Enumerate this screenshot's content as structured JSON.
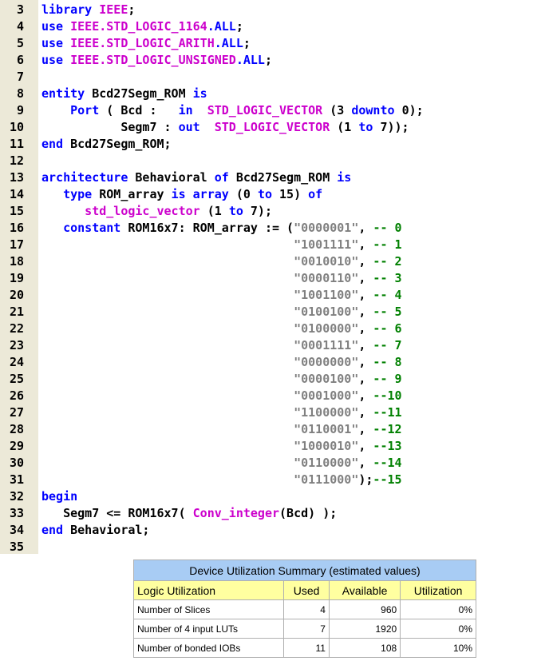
{
  "code_lines": [
    {
      "n": "3",
      "tokens": [
        {
          "t": "library ",
          "c": "kw"
        },
        {
          "t": "IEEE",
          "c": "ty"
        },
        {
          "t": ";",
          "c": "id"
        }
      ]
    },
    {
      "n": "4",
      "tokens": [
        {
          "t": "use ",
          "c": "kw"
        },
        {
          "t": "IEEE.STD_LOGIC_1164",
          "c": "ty"
        },
        {
          "t": ".ALL",
          "c": "kw"
        },
        {
          "t": ";",
          "c": "id"
        }
      ]
    },
    {
      "n": "5",
      "tokens": [
        {
          "t": "use ",
          "c": "kw"
        },
        {
          "t": "IEEE.STD_LOGIC_ARITH",
          "c": "ty"
        },
        {
          "t": ".ALL",
          "c": "kw"
        },
        {
          "t": ";",
          "c": "id"
        }
      ]
    },
    {
      "n": "6",
      "tokens": [
        {
          "t": "use ",
          "c": "kw"
        },
        {
          "t": "IEEE.STD_LOGIC_UNSIGNED",
          "c": "ty"
        },
        {
          "t": ".ALL",
          "c": "kw"
        },
        {
          "t": ";",
          "c": "id"
        }
      ]
    },
    {
      "n": "7",
      "tokens": []
    },
    {
      "n": "8",
      "tokens": [
        {
          "t": "entity ",
          "c": "kw"
        },
        {
          "t": "Bcd27Segm_ROM ",
          "c": "id"
        },
        {
          "t": "is",
          "c": "kw"
        }
      ]
    },
    {
      "n": "9",
      "tokens": [
        {
          "t": "    Port ",
          "c": "kw"
        },
        {
          "t": "( Bcd :   ",
          "c": "id"
        },
        {
          "t": "in  ",
          "c": "kw"
        },
        {
          "t": "STD_LOGIC_VECTOR ",
          "c": "ty"
        },
        {
          "t": "(3 ",
          "c": "id"
        },
        {
          "t": "downto ",
          "c": "kw"
        },
        {
          "t": "0);",
          "c": "id"
        }
      ]
    },
    {
      "n": "10",
      "tokens": [
        {
          "t": "           Segm7 : ",
          "c": "id"
        },
        {
          "t": "out  ",
          "c": "kw"
        },
        {
          "t": "STD_LOGIC_VECTOR ",
          "c": "ty"
        },
        {
          "t": "(1 ",
          "c": "id"
        },
        {
          "t": "to ",
          "c": "kw"
        },
        {
          "t": "7));",
          "c": "id"
        }
      ]
    },
    {
      "n": "11",
      "tokens": [
        {
          "t": "end ",
          "c": "kw"
        },
        {
          "t": "Bcd27Segm_ROM;",
          "c": "id"
        }
      ]
    },
    {
      "n": "12",
      "tokens": []
    },
    {
      "n": "13",
      "tokens": [
        {
          "t": "architecture ",
          "c": "kw"
        },
        {
          "t": "Behavioral ",
          "c": "id"
        },
        {
          "t": "of ",
          "c": "kw"
        },
        {
          "t": "Bcd27Segm_ROM ",
          "c": "id"
        },
        {
          "t": "is",
          "c": "kw"
        }
      ]
    },
    {
      "n": "14",
      "tokens": [
        {
          "t": "   type ",
          "c": "kw"
        },
        {
          "t": "ROM_array ",
          "c": "id"
        },
        {
          "t": "is array ",
          "c": "kw"
        },
        {
          "t": "(0 ",
          "c": "id"
        },
        {
          "t": "to ",
          "c": "kw"
        },
        {
          "t": "15) ",
          "c": "id"
        },
        {
          "t": "of",
          "c": "kw"
        }
      ]
    },
    {
      "n": "15",
      "tokens": [
        {
          "t": "      std_logic_vector ",
          "c": "ty"
        },
        {
          "t": "(1 ",
          "c": "id"
        },
        {
          "t": "to ",
          "c": "kw"
        },
        {
          "t": "7);",
          "c": "id"
        }
      ]
    },
    {
      "n": "16",
      "tokens": [
        {
          "t": "   constant ",
          "c": "kw"
        },
        {
          "t": "ROM16x7: ROM_array := (",
          "c": "id"
        },
        {
          "t": "\"0000001\"",
          "c": "st"
        },
        {
          "t": ", ",
          "c": "id"
        },
        {
          "t": "-- 0",
          "c": "cm"
        }
      ]
    },
    {
      "n": "17",
      "tokens": [
        {
          "t": "                                   \"1001111\"",
          "c": "st"
        },
        {
          "t": ", ",
          "c": "id"
        },
        {
          "t": "-- 1",
          "c": "cm"
        }
      ]
    },
    {
      "n": "18",
      "tokens": [
        {
          "t": "                                   \"0010010\"",
          "c": "st"
        },
        {
          "t": ", ",
          "c": "id"
        },
        {
          "t": "-- 2",
          "c": "cm"
        }
      ]
    },
    {
      "n": "19",
      "tokens": [
        {
          "t": "                                   \"0000110\"",
          "c": "st"
        },
        {
          "t": ", ",
          "c": "id"
        },
        {
          "t": "-- 3",
          "c": "cm"
        }
      ]
    },
    {
      "n": "20",
      "tokens": [
        {
          "t": "                                   \"1001100\"",
          "c": "st"
        },
        {
          "t": ", ",
          "c": "id"
        },
        {
          "t": "-- 4",
          "c": "cm"
        }
      ]
    },
    {
      "n": "21",
      "tokens": [
        {
          "t": "                                   \"0100100\"",
          "c": "st"
        },
        {
          "t": ", ",
          "c": "id"
        },
        {
          "t": "-- 5",
          "c": "cm"
        }
      ]
    },
    {
      "n": "22",
      "tokens": [
        {
          "t": "                                   \"0100000\"",
          "c": "st"
        },
        {
          "t": ", ",
          "c": "id"
        },
        {
          "t": "-- 6",
          "c": "cm"
        }
      ]
    },
    {
      "n": "23",
      "tokens": [
        {
          "t": "                                   \"0001111\"",
          "c": "st"
        },
        {
          "t": ", ",
          "c": "id"
        },
        {
          "t": "-- 7",
          "c": "cm"
        }
      ]
    },
    {
      "n": "24",
      "tokens": [
        {
          "t": "                                   \"0000000\"",
          "c": "st"
        },
        {
          "t": ", ",
          "c": "id"
        },
        {
          "t": "-- 8",
          "c": "cm"
        }
      ]
    },
    {
      "n": "25",
      "tokens": [
        {
          "t": "                                   \"0000100\"",
          "c": "st"
        },
        {
          "t": ", ",
          "c": "id"
        },
        {
          "t": "-- 9",
          "c": "cm"
        }
      ]
    },
    {
      "n": "26",
      "tokens": [
        {
          "t": "                                   \"0001000\"",
          "c": "st"
        },
        {
          "t": ", ",
          "c": "id"
        },
        {
          "t": "--10",
          "c": "cm"
        }
      ]
    },
    {
      "n": "27",
      "tokens": [
        {
          "t": "                                   \"1100000\"",
          "c": "st"
        },
        {
          "t": ", ",
          "c": "id"
        },
        {
          "t": "--11",
          "c": "cm"
        }
      ]
    },
    {
      "n": "28",
      "tokens": [
        {
          "t": "                                   \"0110001\"",
          "c": "st"
        },
        {
          "t": ", ",
          "c": "id"
        },
        {
          "t": "--12",
          "c": "cm"
        }
      ]
    },
    {
      "n": "29",
      "tokens": [
        {
          "t": "                                   \"1000010\"",
          "c": "st"
        },
        {
          "t": ", ",
          "c": "id"
        },
        {
          "t": "--13",
          "c": "cm"
        }
      ]
    },
    {
      "n": "30",
      "tokens": [
        {
          "t": "                                   \"0110000\"",
          "c": "st"
        },
        {
          "t": ", ",
          "c": "id"
        },
        {
          "t": "--14",
          "c": "cm"
        }
      ]
    },
    {
      "n": "31",
      "tokens": [
        {
          "t": "                                   \"0111000\"",
          "c": "st"
        },
        {
          "t": ");",
          "c": "id"
        },
        {
          "t": "--15",
          "c": "cm"
        }
      ]
    },
    {
      "n": "32",
      "tokens": [
        {
          "t": "begin",
          "c": "kw"
        }
      ]
    },
    {
      "n": "33",
      "tokens": [
        {
          "t": "   Segm7 <= ROM16x7( ",
          "c": "id"
        },
        {
          "t": "Conv_integer",
          "c": "ty"
        },
        {
          "t": "(Bcd) );",
          "c": "id"
        }
      ]
    },
    {
      "n": "34",
      "tokens": [
        {
          "t": "end ",
          "c": "kw"
        },
        {
          "t": "Behavioral;",
          "c": "id"
        }
      ]
    },
    {
      "n": "35",
      "tokens": []
    }
  ],
  "summary": {
    "title": "Device Utilization Summary (estimated values)",
    "headers": [
      "Logic Utilization",
      "Used",
      "Available",
      "Utilization"
    ],
    "rows": [
      [
        "Number of Slices",
        "4",
        "960",
        "0%"
      ],
      [
        "Number of 4 input LUTs",
        "7",
        "1920",
        "0%"
      ],
      [
        "Number of bonded IOBs",
        "11",
        "108",
        "10%"
      ]
    ]
  }
}
